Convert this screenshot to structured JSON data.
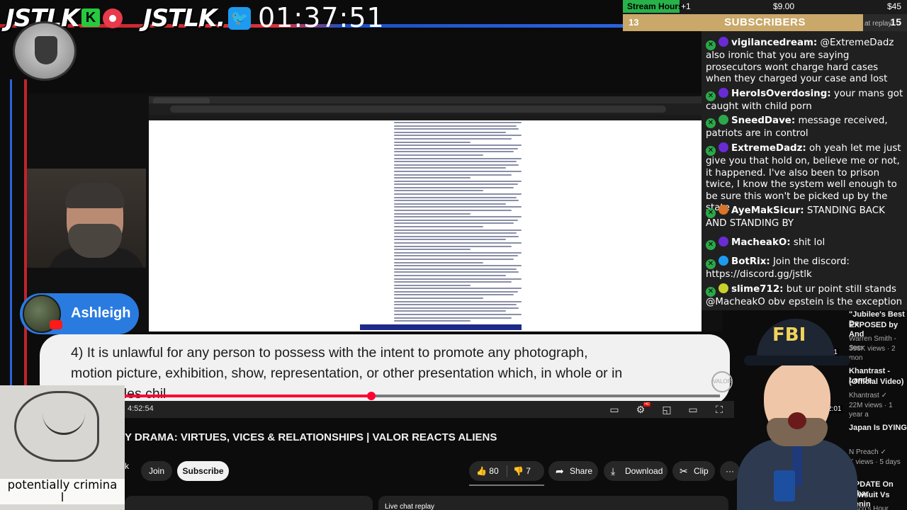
{
  "overlay": {
    "brand_1": "JSTLK",
    "brand_2": "JSTLK.",
    "k_badge": "K",
    "clock": "01:37:51",
    "stream_hours": {
      "label": "Stream Hours",
      "plus": "+1",
      "left_amount": "$9.00",
      "right_amount": "$45"
    },
    "subs": {
      "count": "13",
      "label": "SUBSCRIBERS",
      "right_count": "15",
      "replay": "at replay"
    }
  },
  "video": {
    "host_name": "Ashleigh",
    "caption_line_1": "4)    It is unlawful for any person to possess with the intent to promote any photograph,",
    "caption_line_2": "motion picture, exhibition, show, representation, or other presentation which, in whole or in",
    "caption_line_3": "        cludes chil",
    "time": "4:52:54",
    "progress": 0.414,
    "title": "Y DRAMA: VIRTUES, VICES & RELATIONSHIPS | VALOR REACTS ALIENS",
    "channel_partial": "k",
    "join_label": "Join",
    "subscribe_label": "Subscribe",
    "likes": "80",
    "dislikes": "7",
    "share_label": "Share",
    "download_label": "Download",
    "clip_label": "Clip",
    "more_label": "···",
    "live_chat_label": "Live chat replay",
    "hd_label": "HD"
  },
  "sketch": {
    "caption": "potentially crimina\nl"
  },
  "chat": {
    "messages": [
      {
        "user": "vigilancedream:",
        "avatar_color": "#6a2bd4",
        "text": " @ExtremeDadz also ironic that you are saying prosecutors wont charge hard cases when they charged your case and lost"
      },
      {
        "user": "HeroIsOverdosing:",
        "avatar_color": "#6a2bd4",
        "text": " your mans got caught with child porn"
      },
      {
        "user": "SneedDave:",
        "avatar_color": "#2ba84a",
        "text": " message received, patriots are in control"
      },
      {
        "user": "ExtremeDadz:",
        "avatar_color": "#6a2bd4",
        "text": " oh yeah let me just give you that hold on, believe me or not, it happened. I've also been to prison twice, I know the system well enough to be sure this won't be picked up by the state"
      },
      {
        "user": "AyeMakSicur:",
        "avatar_color": "#d9742a",
        "text": " STANDING BACK AND STANDING BY"
      },
      {
        "user": "MacheakO:",
        "avatar_color": "#6a2bd4",
        "text": " shit lol"
      },
      {
        "user": "BotRix:",
        "avatar_color": "#1d9bf0",
        "text": " Join the discord: https://discord.gg/jstlk"
      },
      {
        "user": "slime712:",
        "avatar_color": "#c9d12a",
        "text": " but ur point still stands @MacheakO obv epstein is the exception"
      }
    ]
  },
  "recommendations": [
    {
      "title_1": "\"Jubilee's Best De",
      "title_2": "EXPOSED by And",
      "meta_1": "Warren Smith - Secr",
      "meta_2": "398K views · 2 mon",
      "duration": ":51"
    },
    {
      "title_1": "Khantrast - Lande",
      "title_2": "(Official Video)",
      "meta_1": "Khantrast ✓",
      "meta_2": "22M views · 1 year a",
      "duration": "2:01"
    },
    {
      "title_1": "Japan Is DYING",
      "title_2": "",
      "meta_1": "N Preach ✓",
      "meta_2": "K views · 5 days",
      "duration": ""
    },
    {
      "title_1": "UPDATE On Ethar",
      "title_2": "Lawsuit Vs Denin",
      "meta_1": "Pisco's Hour",
      "meta_2": "",
      "duration": ""
    }
  ],
  "fbi": {
    "cap_text": "FBI"
  }
}
